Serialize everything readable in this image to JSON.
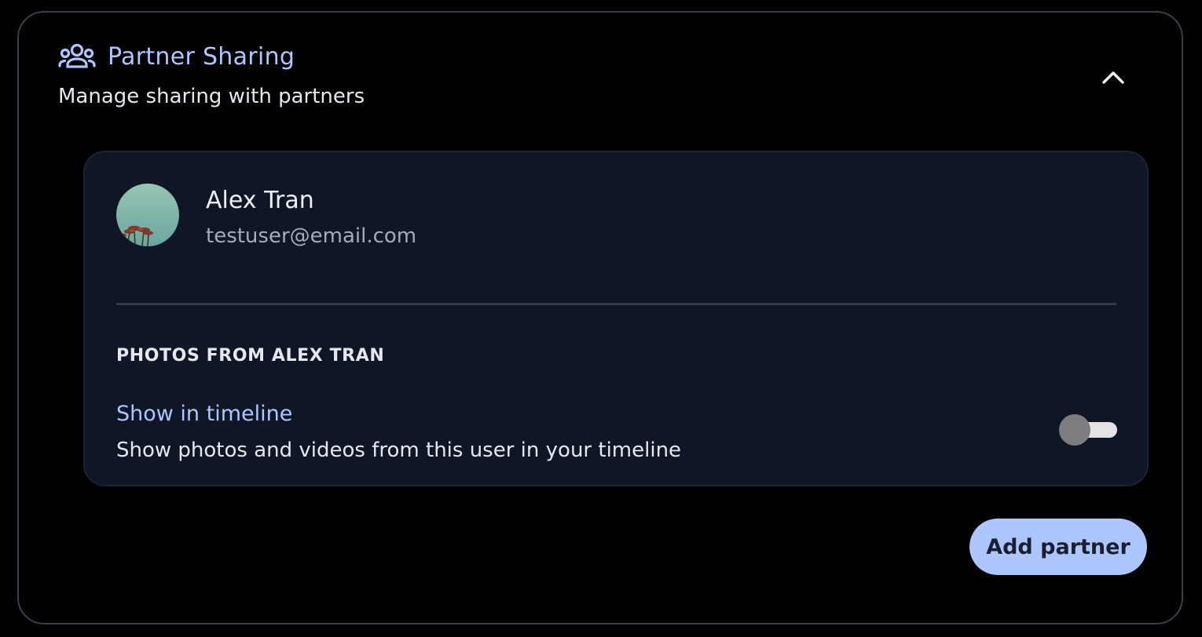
{
  "section": {
    "title": "Partner Sharing",
    "subtitle": "Manage sharing with partners",
    "icon": "users-icon",
    "collapse_icon": "chevron-up-icon"
  },
  "partner": {
    "name": "Alex Tran",
    "email": "testuser@email.com",
    "avatar": "palm-trees-sky-photo",
    "section_heading": "PHOTOS FROM ALEX TRAN",
    "setting": {
      "label": "Show in timeline",
      "description": "Show photos and videos from this user in your timeline",
      "enabled": false
    }
  },
  "actions": {
    "add_partner_label": "Add partner"
  },
  "colors": {
    "accent": "#adc6ff",
    "card_bg": "#0f1727",
    "panel_border": "#3a3f4b",
    "background": "#000000"
  }
}
